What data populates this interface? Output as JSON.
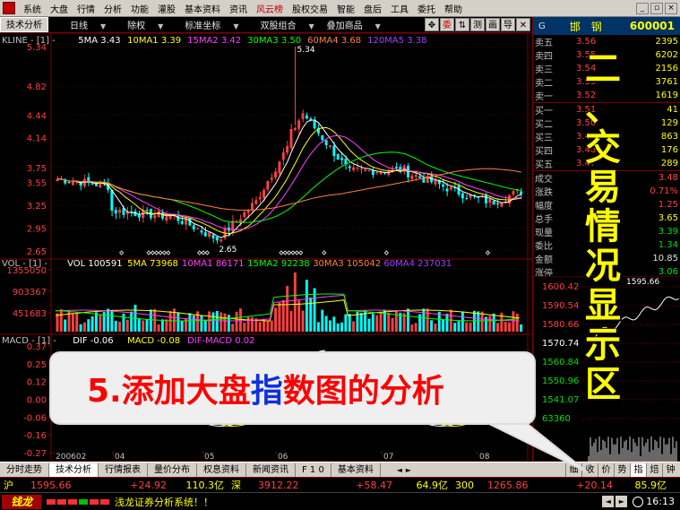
{
  "menu": {
    "items": [
      "系统",
      "大盘",
      "行情",
      "分析",
      "功能",
      "灌股",
      "基本资料",
      "资讯",
      "风云榜",
      "股权交易",
      "智能",
      "盘后",
      "工具",
      "委托",
      "帮助"
    ],
    "active": "风云榜"
  },
  "toolbar": {
    "panel_title": "技术分析",
    "period": "日线",
    "rights": "除权",
    "indicator_coord": "标准坐标",
    "compare": "双股组合",
    "overlay": "叠加商品",
    "buttons": [
      "✥",
      "委",
      "⇅",
      "测",
      "画",
      "导",
      "✕"
    ]
  },
  "kline": {
    "header": [
      "KLINE - [1] -",
      "5MA 3.43",
      "10MA1 3.39",
      "15MA2 3.42",
      "30MA3 3.50",
      "60MA4 3.68",
      "120MA5 3.38"
    ],
    "header_colors": [
      "#c0c0c0",
      "#ffffff",
      "#ffff00",
      "#ff40ff",
      "#00ff00",
      "#ff8040",
      "#a040ff"
    ],
    "y_ticks": [
      "5.34",
      "4.82",
      "4.44",
      "4.14",
      "3.75",
      "3.55",
      "3.25",
      "2.95",
      "2.65"
    ],
    "high_label": "5.34",
    "low_label": "2.65"
  },
  "volume": {
    "header": [
      "VOL - [1] -",
      "VOL 100591",
      "5MA 73968",
      "10MA1 86171",
      "15MA2 92238",
      "30MA3 105042",
      "60MA4 237031"
    ],
    "header_colors": [
      "#c0c0c0",
      "#ffffff",
      "#ffff00",
      "#ff40ff",
      "#00ff00",
      "#ff8040",
      "#a040ff"
    ],
    "y_ticks": [
      "1355050",
      "903367",
      "451683"
    ]
  },
  "macd": {
    "header": [
      "MACD - [1] -",
      "DIF -0.06",
      "MACD -0.08",
      "DIF-MACD 0.02"
    ],
    "header_colors": [
      "#c0c0c0",
      "#ffffff",
      "#ffff00",
      "#ff40ff"
    ],
    "y_ticks": [
      "0.37",
      "0.25",
      "0.12",
      "0.00",
      "-0.06",
      "-0.16",
      "-0.27"
    ]
  },
  "x_axis": [
    "200602",
    "04",
    "05",
    "06",
    "07",
    "08"
  ],
  "stock": {
    "prefix": "G",
    "name": "邯 钢",
    "code": "600001"
  },
  "order_book": {
    "asks": [
      {
        "label": "卖五",
        "price": "3.56",
        "vol": "2395"
      },
      {
        "label": "卖四",
        "price": "3.55",
        "vol": "6202"
      },
      {
        "label": "卖三",
        "price": "3.54",
        "vol": "2156"
      },
      {
        "label": "卖二",
        "price": "3.53",
        "vol": "3761"
      },
      {
        "label": "卖一",
        "price": "3.52",
        "vol": "1619"
      }
    ],
    "bids": [
      {
        "label": "买一",
        "price": "3.51",
        "vol": "41"
      },
      {
        "label": "买二",
        "price": "3.50",
        "vol": "129"
      },
      {
        "label": "买三",
        "price": "3.49",
        "vol": "863"
      },
      {
        "label": "买四",
        "price": "3.48",
        "vol": "176"
      },
      {
        "label": "买五",
        "price": "3.47",
        "vol": "289"
      }
    ]
  },
  "stats": [
    {
      "label": "成交",
      "value": "3.48"
    },
    {
      "label": "涨跌",
      "value": "0.71%"
    },
    {
      "label": "幅度",
      "value": "1.25"
    },
    {
      "label": "总手",
      "value": "3.65"
    },
    {
      "label": "现量",
      "value": "3.39"
    },
    {
      "label": "委比",
      "value": "1.34"
    },
    {
      "label": "金额",
      "value": "10.85"
    },
    {
      "label": "涨停",
      "value": "3.06"
    }
  ],
  "mini_chart": {
    "y_ticks": [
      "1600.42",
      "1590.54",
      "1580.66",
      "1570.74",
      "1560.84",
      "1550.96",
      "1541.07",
      "63360"
    ],
    "price_label": "1595.66"
  },
  "bottom_tabs": {
    "left": [
      "分时走势",
      "技术分析",
      "行情报表",
      "量价分布",
      "权息资料",
      "新闻资讯",
      "F 1 0",
      "基本资料"
    ],
    "active": "技术分析",
    "right": [
      "细",
      "收",
      "价",
      "势",
      "指",
      "焙",
      "钟"
    ],
    "right_active": "指"
  },
  "market": [
    {
      "name": "沪",
      "index": "1595.66",
      "change": "+24.92",
      "amount": "110.3亿"
    },
    {
      "name": "深",
      "index": "3912.22",
      "change": "+58.47",
      "amount": "64.9亿"
    },
    {
      "name": "300",
      "index": "1265.86",
      "change": "+20.14",
      "amount": "85.9亿"
    }
  ],
  "status": {
    "logo": "钱龙",
    "message": "浅龙证券分析系统！！",
    "time": "16:13"
  },
  "callout": {
    "before": "5.添加大盘",
    "highlight": "指",
    "after": "数图的分析"
  },
  "vertical_title": [
    "二",
    "、",
    "交",
    "易",
    "情",
    "况",
    "显",
    "示",
    "区"
  ],
  "colors": {
    "up": "#ff4040",
    "down": "#00ffff",
    "grid": "#800000",
    "ma_white": "#ffffff",
    "ma_yellow": "#ffff00",
    "ma_pink": "#ff40ff",
    "ma_green": "#00ff00"
  }
}
